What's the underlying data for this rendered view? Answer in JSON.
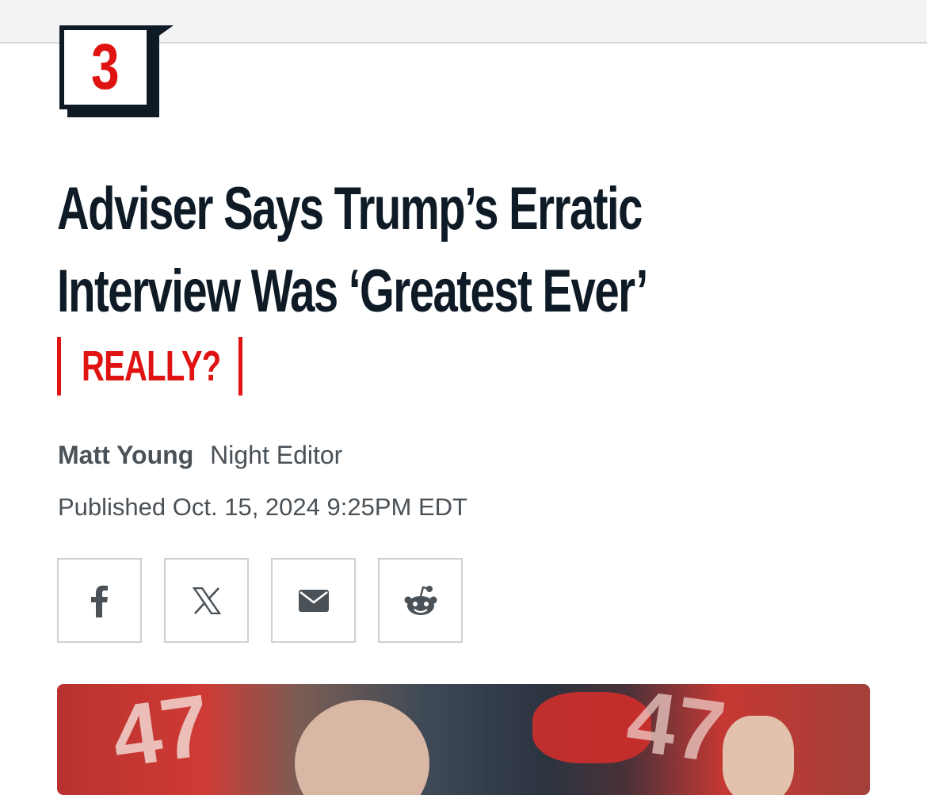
{
  "rank": "3",
  "headline": {
    "line1": "Adviser Says Trump’s Erratic",
    "line2": "Interview Was ‘Greatest Ever’"
  },
  "tag": "REALLY?",
  "byline": {
    "author": "Matt Young",
    "role": "Night Editor"
  },
  "published": "Published Oct. 15, 2024 9:25PM EDT",
  "share": {
    "buttons": [
      {
        "icon": "facebook-icon"
      },
      {
        "icon": "x-icon"
      },
      {
        "icon": "email-icon"
      },
      {
        "icon": "reddit-icon"
      }
    ]
  },
  "colors": {
    "accent": "#e01313",
    "ink": "#0e1b26",
    "meta": "#4a5157"
  }
}
